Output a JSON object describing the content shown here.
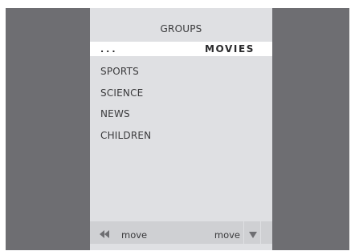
{
  "header": {
    "title": "GROUPS"
  },
  "selected": {
    "dots": "...",
    "label": "MOVIES"
  },
  "items": [
    {
      "label": "SPORTS"
    },
    {
      "label": "SCIENCE"
    },
    {
      "label": "NEWS"
    },
    {
      "label": "CHILDREN"
    }
  ],
  "footer": {
    "left_icon": "rewind-icon",
    "left_label": "move",
    "right_label": "move",
    "right_icon": "down-triangle-icon"
  },
  "colors": {
    "outer_bg": "#6e6e72",
    "panel_bg": "#dfe0e3",
    "selected_row_bg": "#ffffff",
    "footer_bg": "#cfd0d3",
    "text": "#3a3a3c"
  }
}
